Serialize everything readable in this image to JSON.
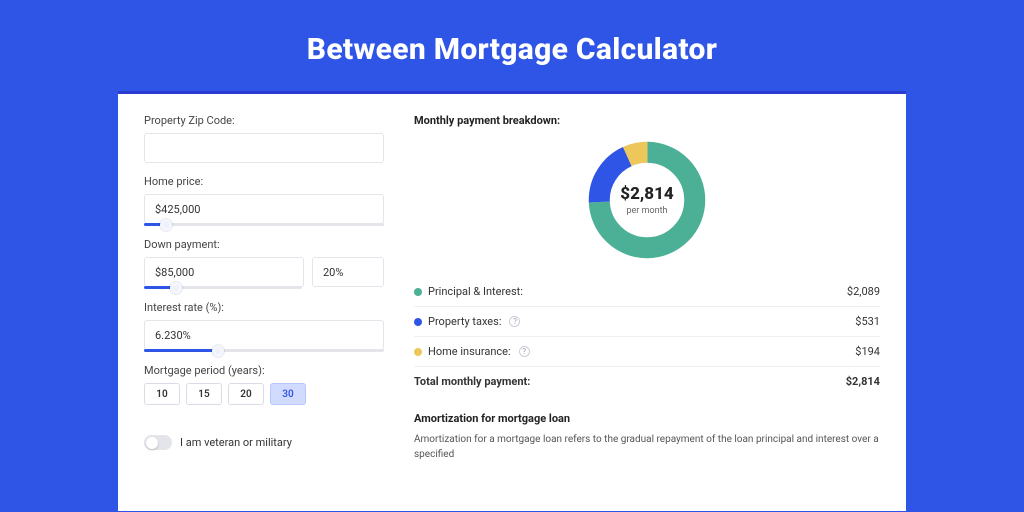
{
  "title": "Between Mortgage Calculator",
  "form": {
    "zip": {
      "label": "Property Zip Code:",
      "value": ""
    },
    "price": {
      "label": "Home price:",
      "value": "$425,000",
      "slider_pct": 9
    },
    "down": {
      "label": "Down payment:",
      "amount": "$85,000",
      "percent": "20%",
      "slider_pct": 20
    },
    "rate": {
      "label": "Interest rate (%):",
      "value": "6.230%",
      "slider_pct": 31
    },
    "period": {
      "label": "Mortgage period (years):",
      "options": [
        "10",
        "15",
        "20",
        "30"
      ],
      "active": "30"
    },
    "vet": {
      "label": "I am veteran or military",
      "on": false
    }
  },
  "breakdown": {
    "title": "Monthly payment breakdown:",
    "center_amount": "$2,814",
    "center_sub": "per month",
    "items": [
      {
        "key": "pi",
        "label": "Principal & Interest:",
        "value": "$2,089",
        "color": "#4bb095",
        "help": false
      },
      {
        "key": "tax",
        "label": "Property taxes:",
        "value": "$531",
        "color": "#2f55e6",
        "help": true
      },
      {
        "key": "ins",
        "label": "Home insurance:",
        "value": "$194",
        "color": "#eec75b",
        "help": true
      }
    ],
    "total_label": "Total monthly payment:",
    "total_value": "$2,814"
  },
  "amort": {
    "title": "Amortization for mortgage loan",
    "text": "Amortization for a mortgage loan refers to the gradual repayment of the loan principal and interest over a specified"
  },
  "chart_data": {
    "type": "pie",
    "title": "Monthly payment breakdown",
    "series": [
      {
        "name": "Principal & Interest",
        "value": 2089,
        "color": "#4bb095"
      },
      {
        "name": "Property taxes",
        "value": 531,
        "color": "#2f55e6"
      },
      {
        "name": "Home insurance",
        "value": 194,
        "color": "#eec75b"
      }
    ],
    "total": 2814,
    "center_label": "$2,814 per month",
    "donut": true
  }
}
